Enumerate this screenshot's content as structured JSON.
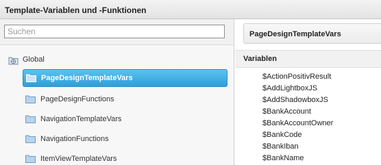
{
  "window": {
    "title": "Template-Variablen und -Funktionen"
  },
  "search": {
    "placeholder": "Suchen",
    "value": ""
  },
  "tree": {
    "root": {
      "label": "Global",
      "icon": "global-folder-icon"
    },
    "items": [
      {
        "label": "PageDesignTemplateVars",
        "selected": true,
        "icon": "folder-icon"
      },
      {
        "label": "PageDesignFunctions",
        "selected": false,
        "icon": "folder-icon"
      },
      {
        "label": "NavigationTemplateVars",
        "selected": false,
        "icon": "folder-icon"
      },
      {
        "label": "NavigationFunctions",
        "selected": false,
        "icon": "folder-icon"
      },
      {
        "label": "ItemViewTemplateVars",
        "selected": false,
        "icon": "folder-icon"
      }
    ]
  },
  "detail": {
    "title": "PageDesignTemplateVars",
    "section_label": "Variablen",
    "variables": [
      "$ActionPositivResult",
      "$AddLightboxJS",
      "$AddShadowboxJS",
      "$BankAccount",
      "$BankAccountOwner",
      "$BankCode",
      "$BankIban",
      "$BankName"
    ]
  },
  "colors": {
    "selection_top": "#5cc2ee",
    "selection_bottom": "#2e9fd9",
    "folder": "#7fb2dd"
  }
}
